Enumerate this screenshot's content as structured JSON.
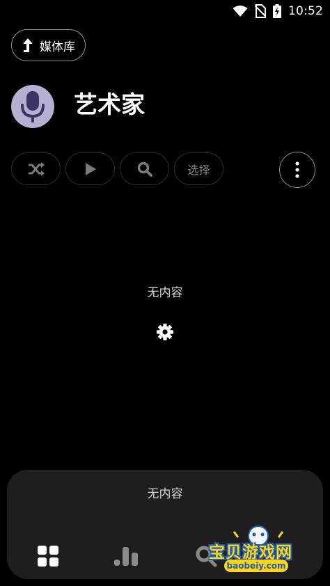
{
  "status_bar": {
    "time": "10:52",
    "icons": [
      "wifi-icon",
      "no-sim-icon",
      "battery-charging-icon"
    ]
  },
  "header": {
    "back_label": "媒体库",
    "back_icon": "arrow-up-turn-icon",
    "title": "艺术家",
    "avatar_icon": "microphone-icon",
    "avatar_color": "#b5b0d2"
  },
  "actions": {
    "shuffle_icon": "shuffle-icon",
    "play_icon": "play-icon",
    "search_icon": "search-icon",
    "select_label": "选择",
    "more_icon": "more-vertical-icon"
  },
  "content": {
    "empty_text": "无内容",
    "settings_icon": "gear-icon"
  },
  "bottom_panel": {
    "empty_text": "无内容",
    "nav": [
      "grid-icon",
      "bar-chart-icon",
      "search-icon"
    ]
  },
  "watermark": {
    "title": "宝贝游戏网",
    "url": "baobeiy.com"
  }
}
